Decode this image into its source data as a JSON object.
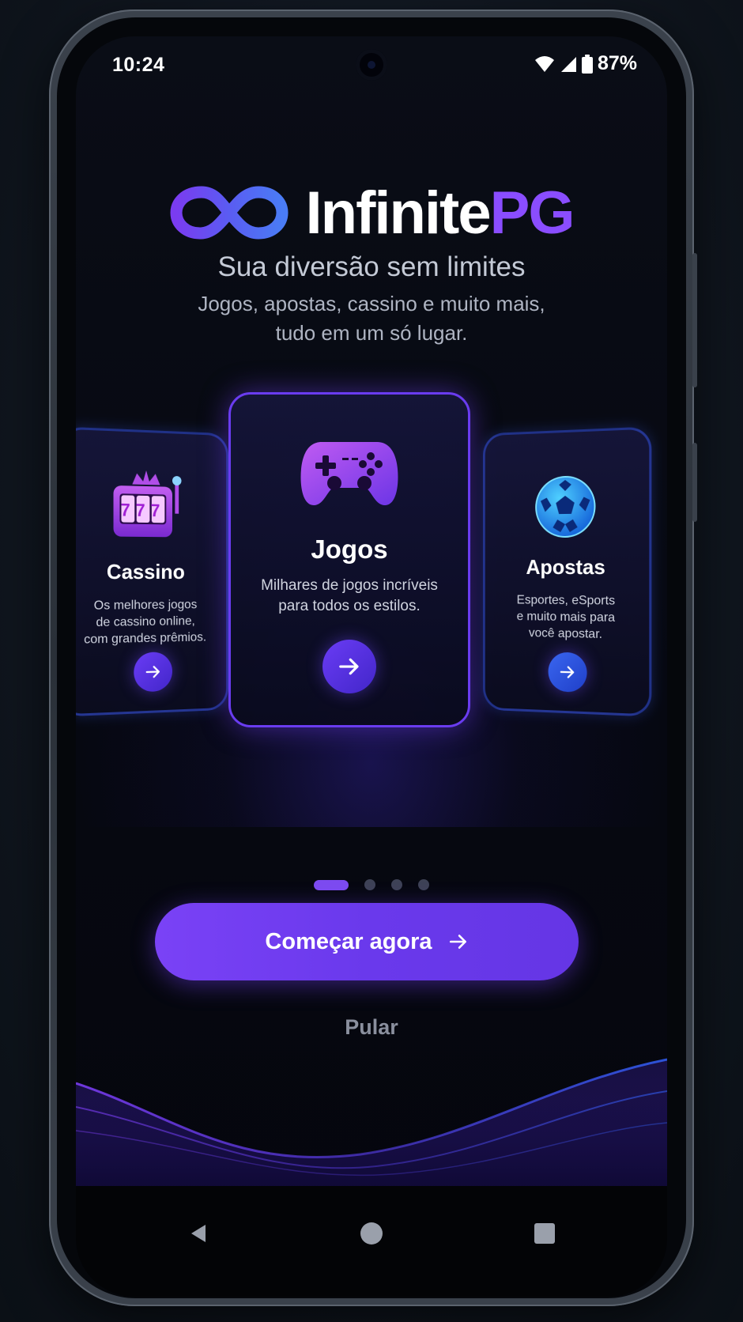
{
  "status_bar": {
    "time": "10:24",
    "battery": "87%",
    "icons": [
      "wifi-icon",
      "signal-icon",
      "battery-icon"
    ]
  },
  "brand": {
    "name_main": "Infinite",
    "name_accent": "PG",
    "logo_icon": "infinity-logo-icon"
  },
  "hero": {
    "headline": "Sua diversão sem limites",
    "subline_1": "Jogos, apostas, cassino e muito mais,",
    "subline_2": "tudo em um só lugar."
  },
  "cards": [
    {
      "title": "Cassino",
      "line_1": "Os melhores jogos",
      "line_2": "de cassino online,",
      "line_3": "com grandes prêmios.",
      "icon": "slot-machine-icon",
      "slot_digits": "777"
    },
    {
      "title": "Jogos",
      "line_1": "Milhares de jogos incríveis",
      "line_2": "para todos os estilos.",
      "icon": "gamepad-icon"
    },
    {
      "title": "Apostas",
      "line_1": "Esportes, eSports",
      "line_2": "e muito mais para",
      "line_3": "você apostar.",
      "icon": "soccer-ball-icon"
    }
  ],
  "pagination": {
    "total": 4,
    "active_index": 0
  },
  "actions": {
    "primary_label": "Começar agora",
    "skip_label": "Pular"
  },
  "nav": [
    "back-icon",
    "home-icon",
    "recents-icon"
  ],
  "colors": {
    "accent": "#7a42f6",
    "accent_blue": "#2f5bea",
    "background": "#060811"
  }
}
